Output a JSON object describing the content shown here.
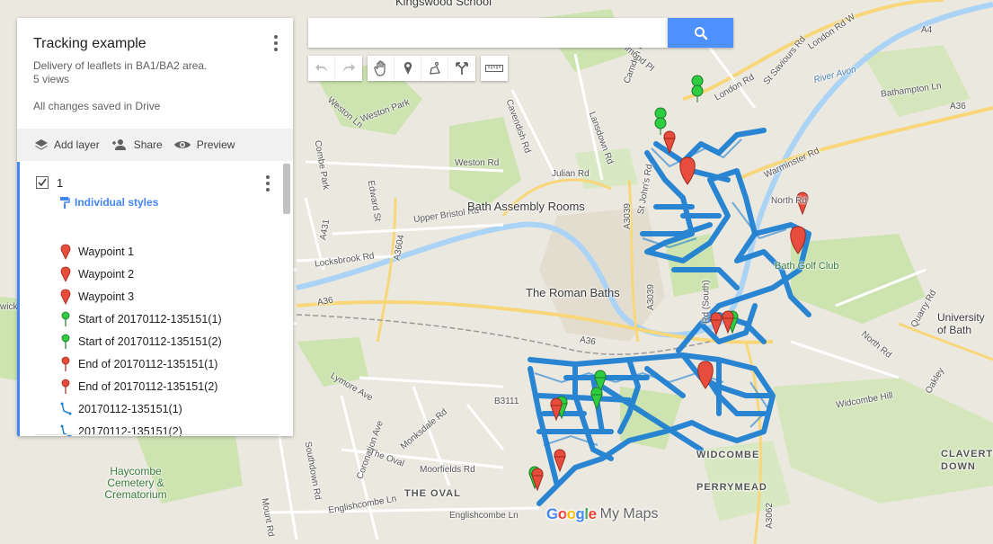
{
  "panel": {
    "title": "Tracking example",
    "description": "Delivery of leaflets in BA1/BA2 area.",
    "views": "5 views",
    "saved_status": "All changes saved in Drive",
    "actions": {
      "add_layer": "Add layer",
      "share": "Share",
      "preview": "Preview"
    },
    "layer": {
      "name": "1",
      "styles_label": "Individual styles",
      "items": [
        {
          "label": "Waypoint 1",
          "icon": "red-marker-icon"
        },
        {
          "label": "Waypoint 2",
          "icon": "red-marker-icon"
        },
        {
          "label": "Waypoint 3",
          "icon": "red-marker-icon"
        },
        {
          "label": "Start of 20170112-135151(1)",
          "icon": "green-pin-icon"
        },
        {
          "label": "Start of 20170112-135151(2)",
          "icon": "green-pin-icon"
        },
        {
          "label": "End of 20170112-135151(1)",
          "icon": "red-pin-icon"
        },
        {
          "label": "End of 20170112-135151(2)",
          "icon": "red-pin-icon"
        },
        {
          "label": "20170112-135151(1)",
          "icon": "line-path-icon"
        },
        {
          "label": "20170112-135151(2)",
          "icon": "line-path-icon"
        }
      ]
    }
  },
  "search": {
    "value": "",
    "placeholder": ""
  },
  "tools": [
    "undo-icon",
    "redo-icon",
    "hand-icon",
    "marker-icon",
    "draw-line-icon",
    "directions-icon",
    "ruler-icon"
  ],
  "map_labels": {
    "kingswood": "Kingswood School",
    "camden": "Camden Rd",
    "london_rd": "London Rd",
    "london_rd_w": "London Rd W",
    "a4": "A4",
    "river_avon": "River Avon",
    "bathampton": "Bathampton Ln",
    "a36_e": "A36",
    "warminster": "Warminster Rd",
    "north_rd": "North Rd",
    "st_saviours": "St Saviours Rd",
    "weston_park": "Weston Park",
    "weston_ln": "Weston Ln",
    "weston_rd": "Weston Rd",
    "cavendish": "Cavendish Rd",
    "julian": "Julian Rd",
    "lansdown": "Lansdown Rd",
    "st_johns": "St John's Rd",
    "combe_park": "Combe Park",
    "edward": "Edward St",
    "upper_bristol": "Upper Bristol Rd",
    "a431": "A431",
    "a3604": "A3604",
    "locksbrook": "Locksbrook Rd",
    "assembly_rooms": "Bath Assembly Rooms",
    "roman_baths": "The Roman Baths",
    "a3039": "A3039",
    "a3039b": "A3039",
    "a36_w": "A36",
    "a36_c": "A36",
    "bath_golf": "Bath Golf Club",
    "quarry": "Quarry Rd",
    "university": "University of Bath",
    "north_rd_s": "North Rd",
    "oakley": "Oakley",
    "widcombe_hill": "Widcombe Hill",
    "claverton": "CLAVERTON DOWN",
    "widcombe": "WIDCOMBE",
    "perrymead": "PERRYMEAD",
    "a3062": "A3062",
    "b3111": "B3111",
    "lymore": "Lymore Ave",
    "coronation": "Coronation Ave",
    "monksdale": "Monksdale Rd",
    "the_oval_rd": "The Oval",
    "moorfields": "Moorfields Rd",
    "the_oval": "THE OVAL",
    "englishcombe": "Englishcombe Ln",
    "englishcombe2": "Englishcombe Ln",
    "haycombe": "Haycombe Cemetery & Crematorium",
    "southdown": "Southdown Rd",
    "mount_rd": "Mount Rd",
    "rd_south": "Rd (South)",
    "richmond": "Richmond Pl",
    "wick": "wick"
  },
  "logo": {
    "google": "Google",
    "my_maps": "My Maps"
  },
  "colors": {
    "track": "#1f7fd1",
    "red_marker": "#e74c3c",
    "green_marker": "#2ecc40",
    "accent": "#4285f4",
    "search_button": "#4d90fe"
  }
}
